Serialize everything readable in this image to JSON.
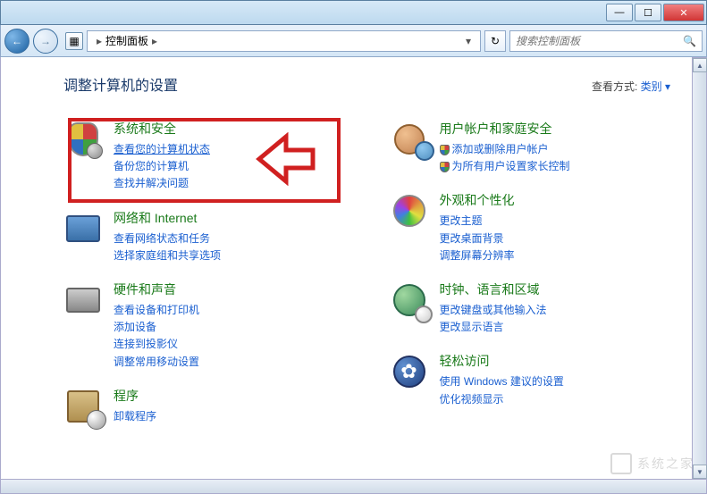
{
  "window": {
    "min": "—",
    "max": "☐",
    "close": "✕"
  },
  "nav": {
    "back": "←",
    "fwd": "→",
    "breadcrumb_root": "控制面板",
    "breadcrumb_sep": "▸",
    "refresh": "↻"
  },
  "search": {
    "placeholder": "搜索控制面板",
    "icon": "🔍"
  },
  "header": {
    "title": "调整计算机的设置",
    "viewby_label": "查看方式:",
    "viewby_value": "类别 ▾"
  },
  "left_cats": [
    {
      "id": "system-security",
      "title": "系统和安全",
      "links": [
        "查看您的计算机状态",
        "备份您的计算机",
        "查找并解决问题"
      ]
    },
    {
      "id": "network-internet",
      "title": "网络和 Internet",
      "links": [
        "查看网络状态和任务",
        "选择家庭组和共享选项"
      ]
    },
    {
      "id": "hardware-sound",
      "title": "硬件和声音",
      "links": [
        "查看设备和打印机",
        "添加设备",
        "连接到投影仪",
        "调整常用移动设置"
      ]
    },
    {
      "id": "programs",
      "title": "程序",
      "links": [
        "卸载程序"
      ]
    }
  ],
  "right_cats": [
    {
      "id": "user-accounts",
      "title": "用户帐户和家庭安全",
      "shield_links": [
        "添加或删除用户帐户",
        "为所有用户设置家长控制"
      ]
    },
    {
      "id": "appearance",
      "title": "外观和个性化",
      "links": [
        "更改主题",
        "更改桌面背景",
        "调整屏幕分辨率"
      ]
    },
    {
      "id": "clock-lang",
      "title": "时钟、语言和区域",
      "links": [
        "更改键盘或其他输入法",
        "更改显示语言"
      ]
    },
    {
      "id": "ease-of-access",
      "title": "轻松访问",
      "links": [
        "使用 Windows 建议的设置",
        "优化视频显示"
      ]
    }
  ],
  "watermark": "系统之家",
  "ease_icon_glyph": "✿"
}
